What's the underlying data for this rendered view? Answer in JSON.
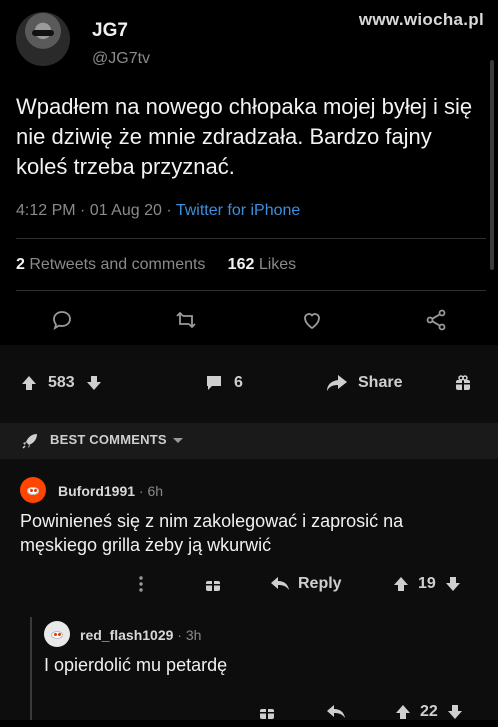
{
  "tweet": {
    "display_name": "JG7",
    "handle": "@JG7tv",
    "text": "Wpadłem na nowego chłopaka mojej byłej i się nie dziwię że mnie zdradzała. Bardzo fajny koleś trzeba przyznać.",
    "time": "4:12 PM · 01 Aug 20 · ",
    "source": "Twitter for iPhone",
    "retweets_count": "2",
    "retweets_label": " Retweets and comments",
    "likes_count": "162",
    "likes_label": " Likes"
  },
  "watermark": "www.wiocha.pl",
  "post_bar": {
    "score": "583",
    "comments": "6",
    "share": "Share"
  },
  "section": {
    "label": "BEST COMMENTS"
  },
  "comments": [
    {
      "author": "Buford1991",
      "time": "6h",
      "text": "Powinieneś się z nim zakolegować i zaprosić na męskiego grilla żeby ją wkurwić",
      "reply": "Reply",
      "score": "19"
    },
    {
      "author": "red_flash1029",
      "time": "3h",
      "text": "I opierdolić mu petardę",
      "score": "22"
    }
  ],
  "colors": {
    "link_blue": "#3b8fdc",
    "upvote": "#cfcfcf",
    "snoo_red": "#ff4500"
  }
}
